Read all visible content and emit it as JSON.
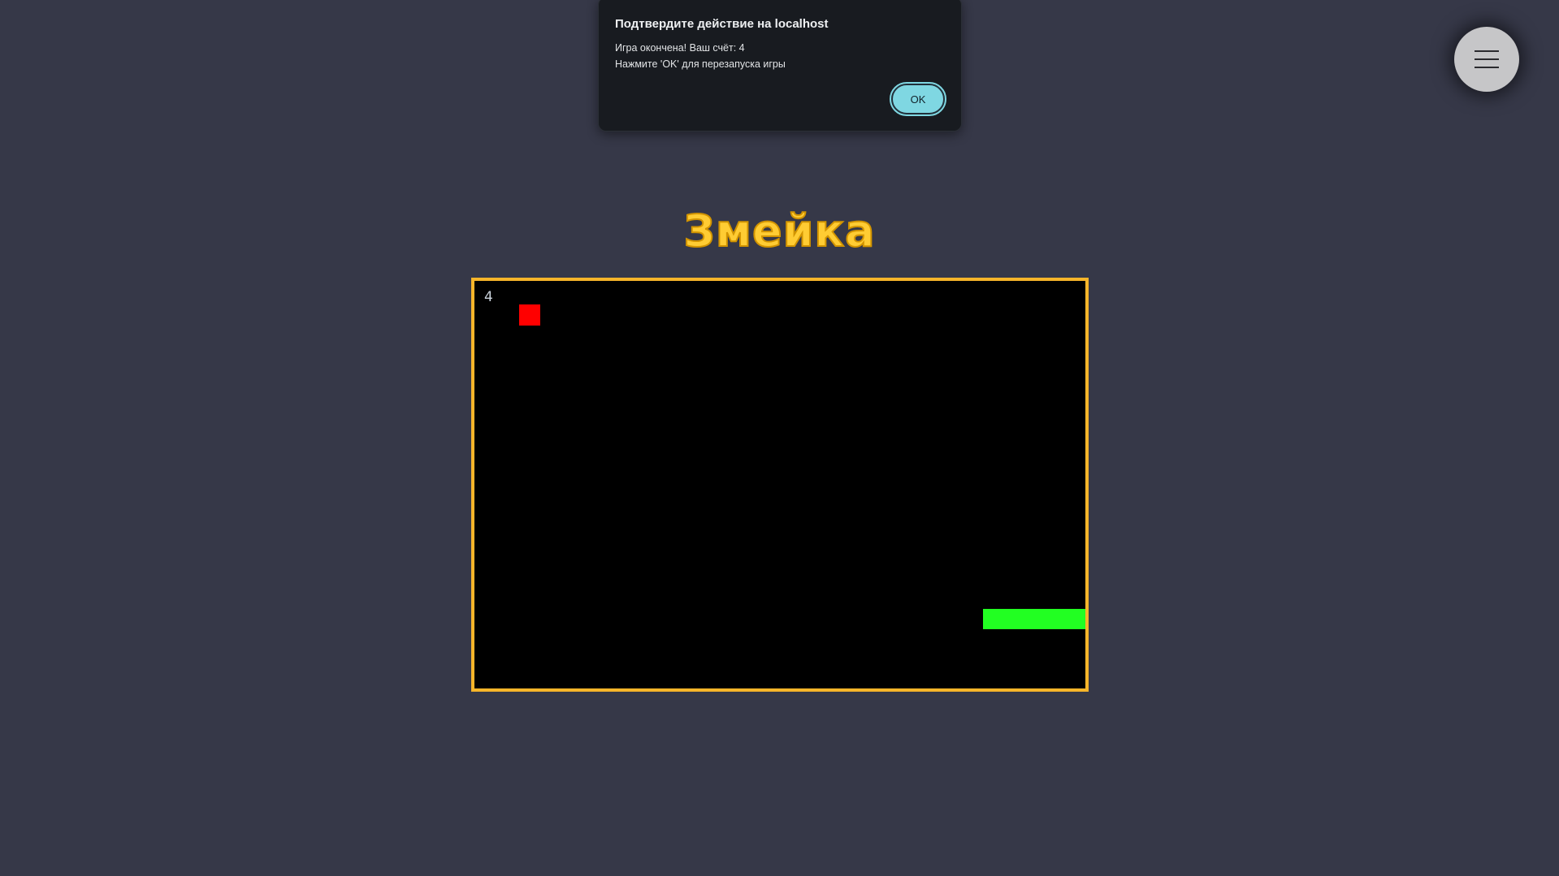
{
  "dialog": {
    "title": "Подтвердите действие на localhost",
    "message_line1": "Игра окончена! Ваш счёт: 4",
    "message_line2": "Нажмите 'OK' для перезапуска игры",
    "ok_label": "OK"
  },
  "menu": {
    "icon": "hamburger-menu-icon"
  },
  "game": {
    "title": "Змейка",
    "score": "4",
    "colors": {
      "board_border": "#f7b52a",
      "food": "#ff0000",
      "snake": "#22ff22",
      "title": "#ffcc33"
    }
  }
}
